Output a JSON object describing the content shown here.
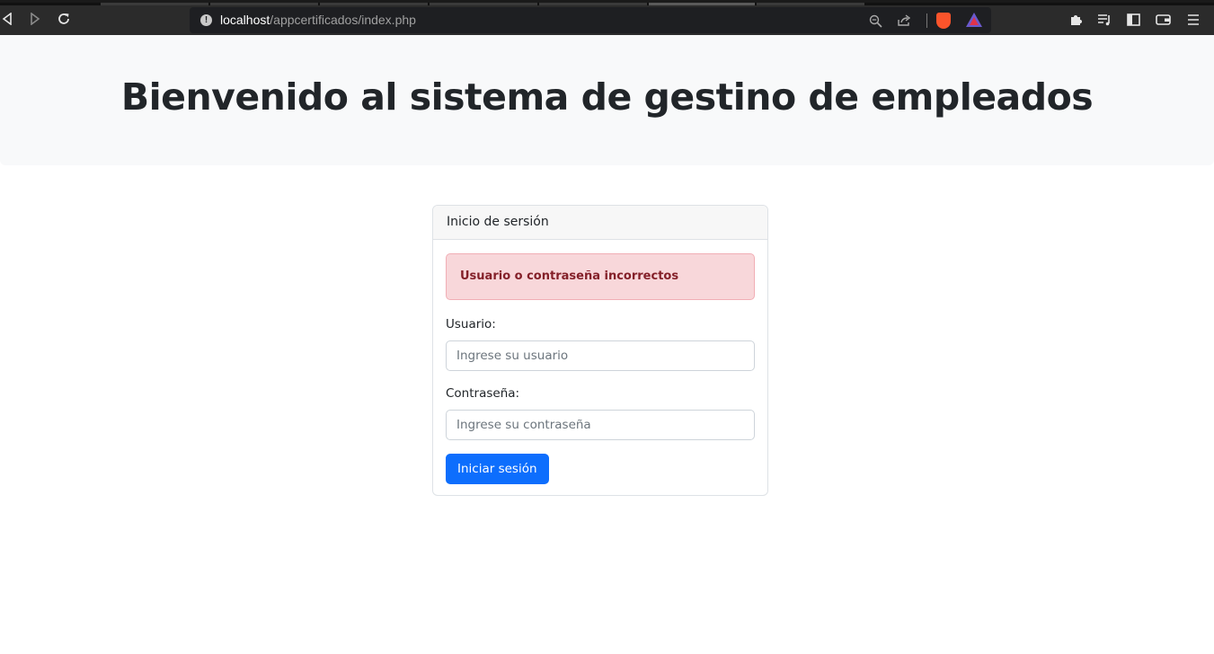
{
  "browser": {
    "url_host": "localhost",
    "url_path": "/appcertificados/index.php"
  },
  "page": {
    "heading": "Bienvenido al sistema de gestino de empleados"
  },
  "login_card": {
    "header": "Inicio de sersión",
    "alert": "Usuario o contraseña incorrectos",
    "username_label": "Usuario:",
    "username_placeholder": "Ingrese su usuario",
    "password_label": "Contraseña:",
    "password_placeholder": "Ingrese su contraseña",
    "submit_label": "Iniciar sesión"
  },
  "colors": {
    "primary": "#0d6efd",
    "alert_bg": "#f8d7da",
    "alert_text": "#842029",
    "hero_bg": "#f8f9fa"
  }
}
